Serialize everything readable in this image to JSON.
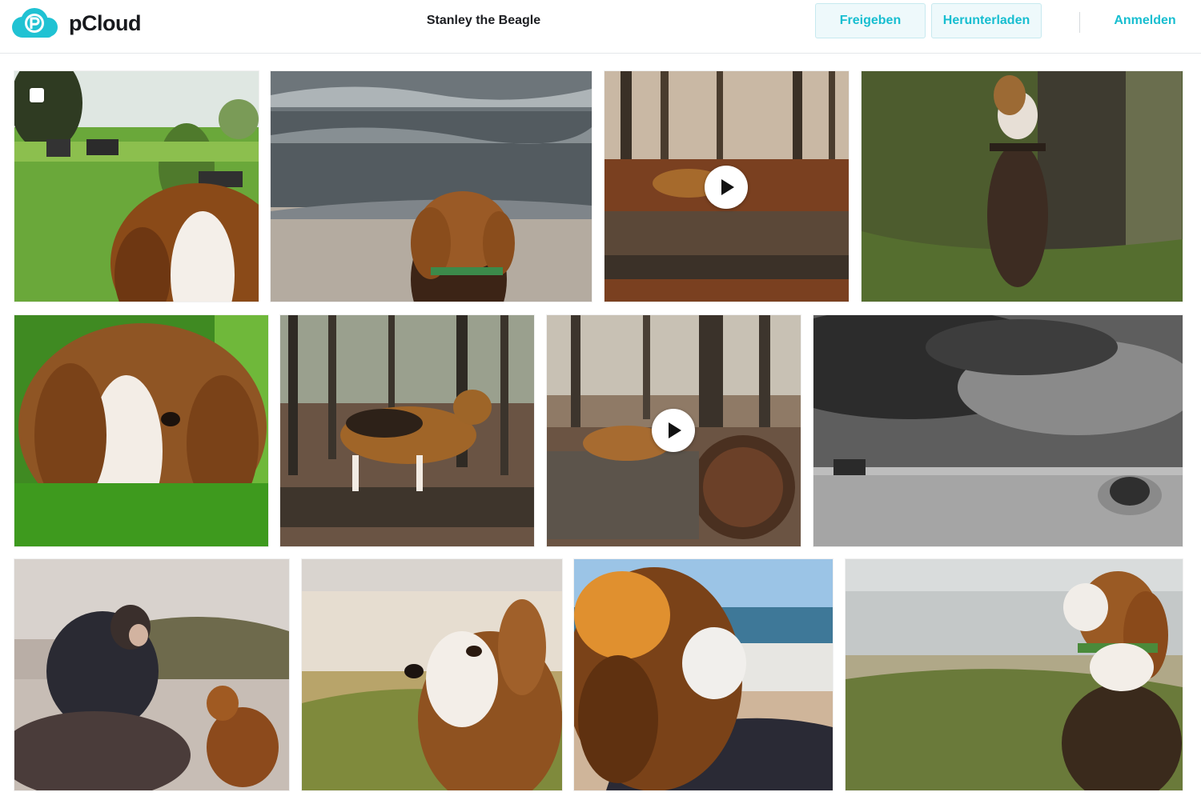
{
  "app": {
    "name": "pCloud"
  },
  "header": {
    "title": "Stanley the Beagle",
    "share_label": "Freigeben",
    "download_label": "Herunterladen",
    "signin_label": "Anmelden"
  },
  "colors": {
    "accent": "#17bed0",
    "button_bg": "#eef9fb",
    "text": "#1c1e22"
  },
  "gallery": {
    "items": [
      {
        "type": "photo",
        "selectable": true
      },
      {
        "type": "photo"
      },
      {
        "type": "video",
        "icon": "play-icon"
      },
      {
        "type": "photo"
      },
      {
        "type": "photo"
      },
      {
        "type": "photo"
      },
      {
        "type": "video",
        "icon": "play-icon"
      },
      {
        "type": "photo"
      },
      {
        "type": "photo"
      },
      {
        "type": "photo"
      },
      {
        "type": "photo"
      },
      {
        "type": "photo"
      }
    ]
  }
}
